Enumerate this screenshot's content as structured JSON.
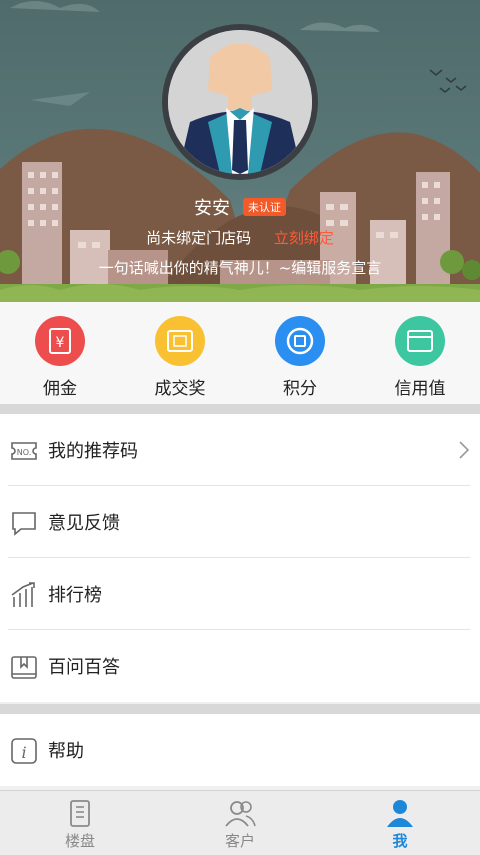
{
  "profile": {
    "name": "安安",
    "badge": "未认证",
    "store_hint": "尚未绑定门店码",
    "bind_link": "立刻绑定",
    "slogan": "一句话喊出你的精气神儿！~编辑服务宣言"
  },
  "quick_actions": [
    {
      "label": "佣金",
      "color": "#ee4d4d",
      "icon": "yen-icon"
    },
    {
      "label": "成交奖",
      "color": "#f9c132",
      "icon": "ticket-icon"
    },
    {
      "label": "积分",
      "color": "#2a8ff0",
      "icon": "points-icon"
    },
    {
      "label": "信用值",
      "color": "#3cc7a0",
      "icon": "card-icon"
    }
  ],
  "menu": [
    {
      "label": "我的推荐码",
      "icon": "no-code-icon"
    },
    {
      "label": "意见反馈",
      "icon": "feedback-icon"
    },
    {
      "label": "排行榜",
      "icon": "ranking-icon"
    },
    {
      "label": "百问百答",
      "icon": "qa-book-icon"
    }
  ],
  "menu2": [
    {
      "label": "帮助",
      "icon": "info-icon"
    }
  ],
  "tabs": [
    {
      "label": "楼盘",
      "icon": "building-icon",
      "active": false
    },
    {
      "label": "客户",
      "icon": "customers-icon",
      "active": false
    },
    {
      "label": "我",
      "icon": "me-icon",
      "active": true
    }
  ],
  "colors": {
    "accent": "#1e88d8",
    "bind_link": "#ff5a3a",
    "badge": "#f25a2a"
  }
}
